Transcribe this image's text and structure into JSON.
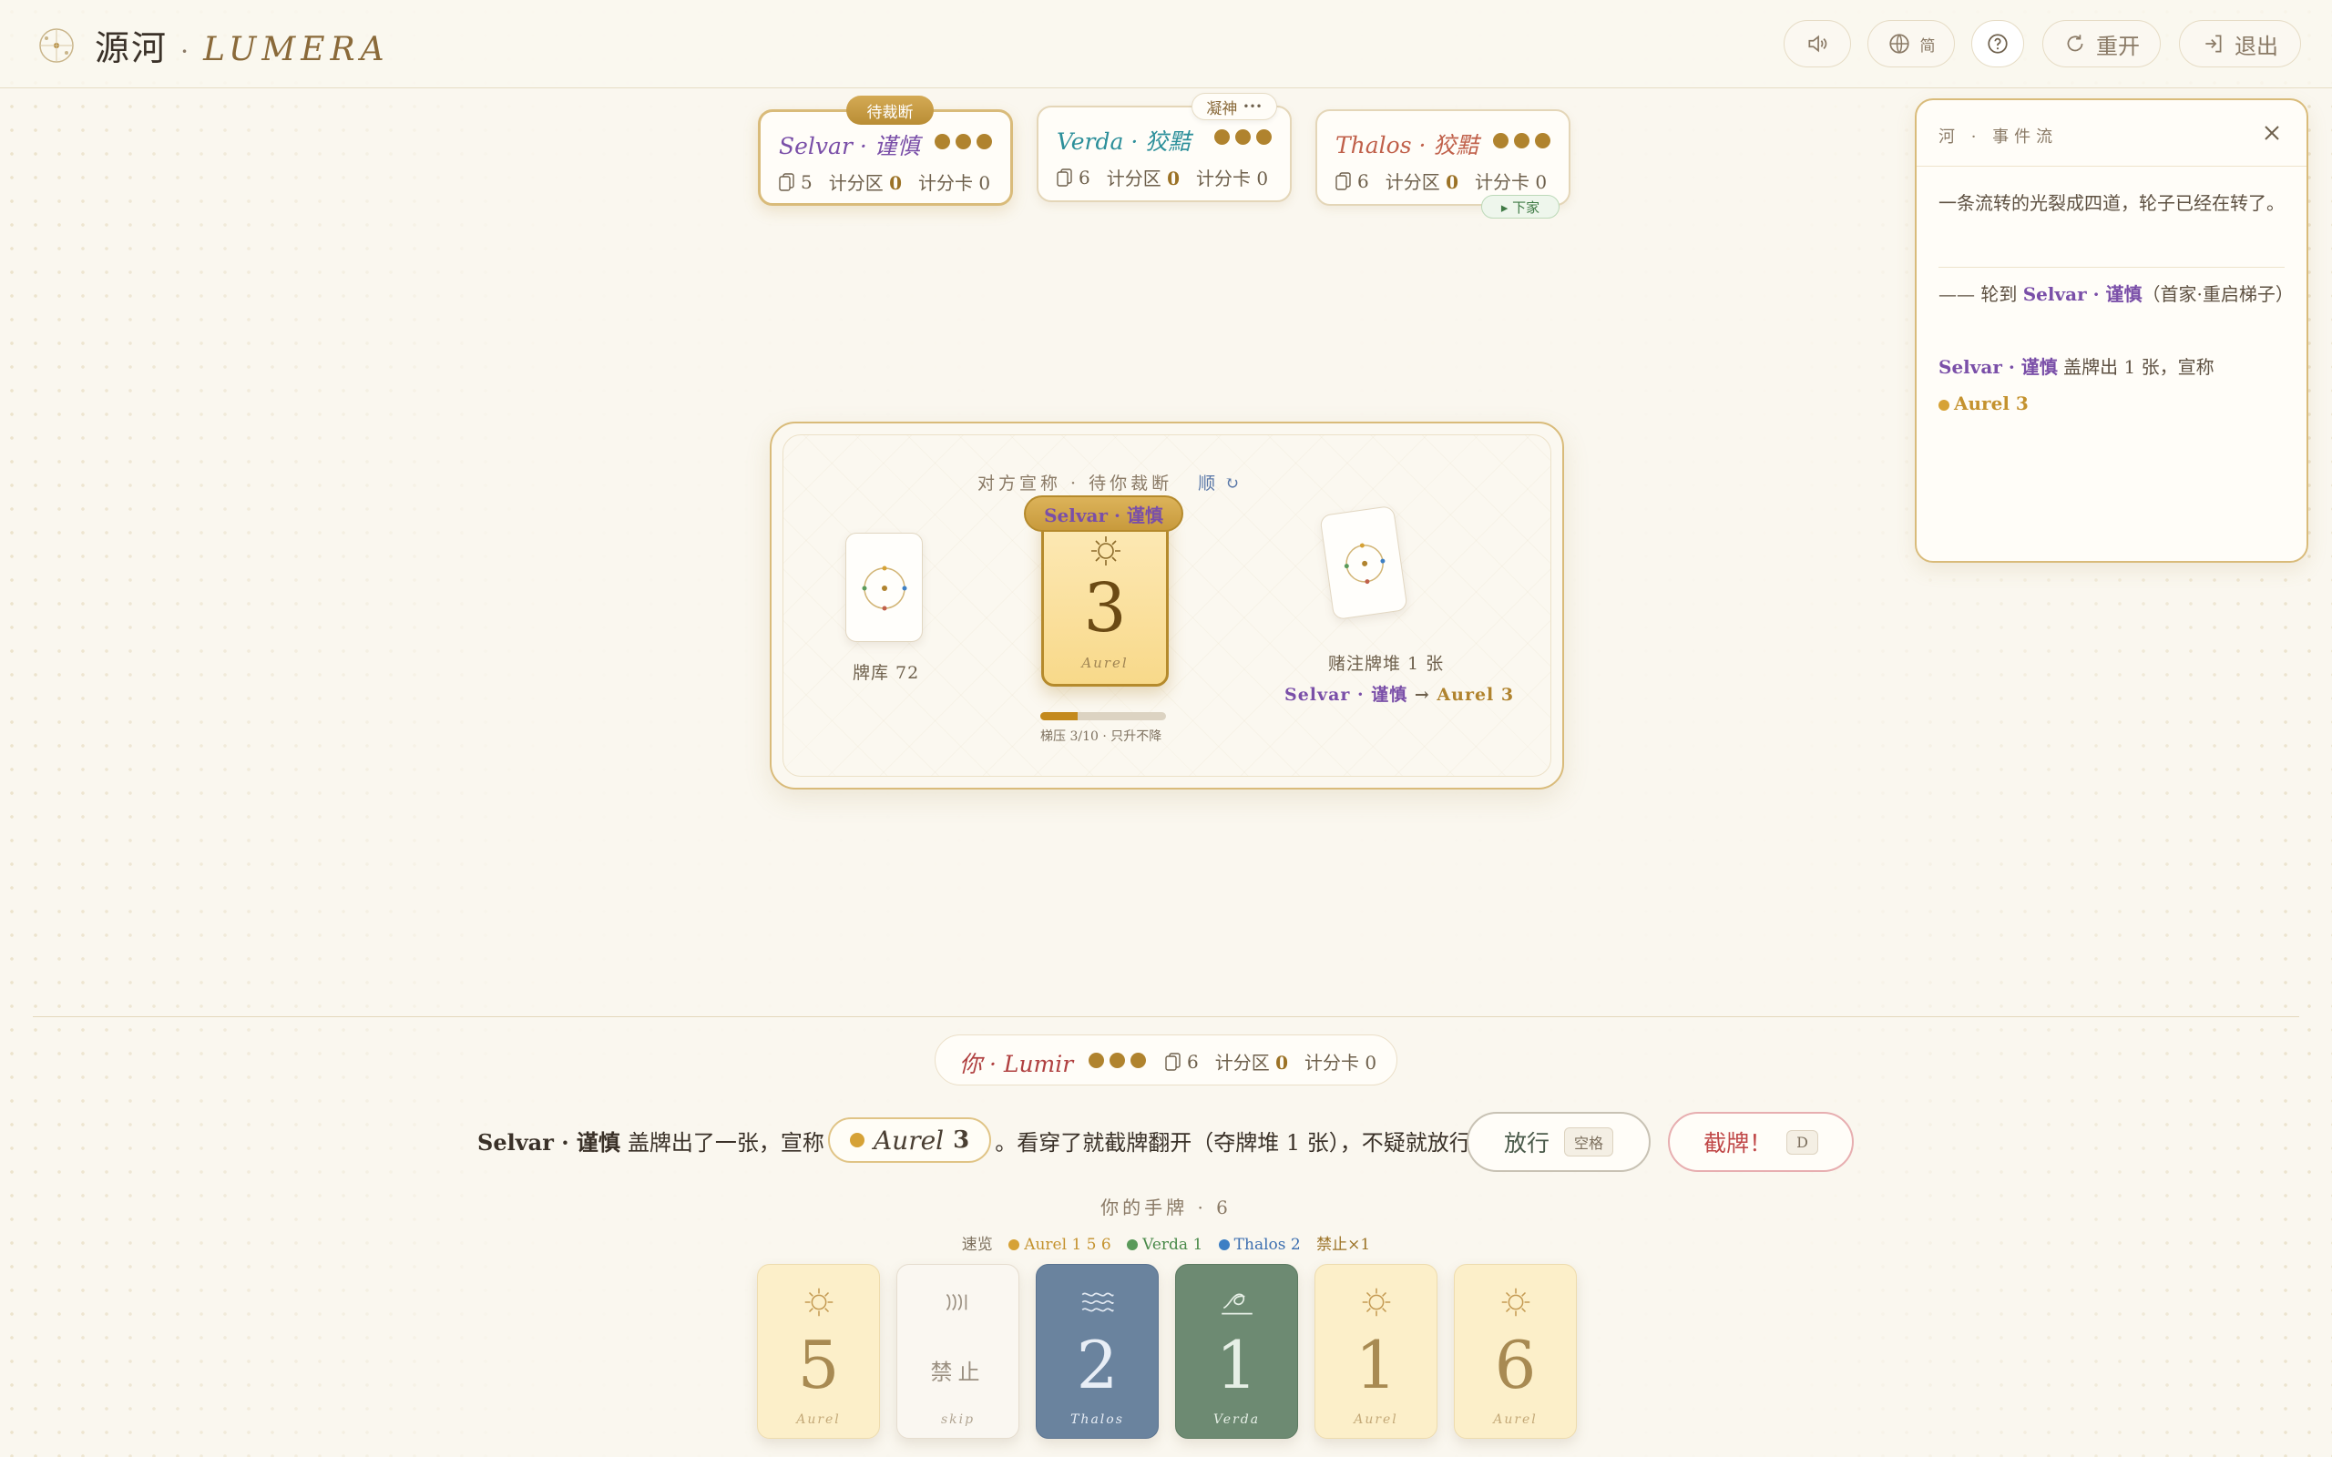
{
  "header": {
    "app_name": "源河",
    "sep": "·",
    "latin_name": "LUMERA",
    "lang_label": "简",
    "restart_label": "重开",
    "exit_label": "退出"
  },
  "players": [
    {
      "name": "Selvar · 谨慎",
      "deck": "5",
      "zone_label": "计分区",
      "zone_value": "0",
      "card_label": "计分卡",
      "card_value": "0",
      "badge": "待裁断",
      "color": "#7a4fa8"
    },
    {
      "name": "Verda · 狡黠",
      "deck": "6",
      "zone_label": "计分区",
      "zone_value": "0",
      "card_label": "计分卡",
      "card_value": "0",
      "badge": "凝神",
      "color": "#2c8f9a"
    },
    {
      "name": "Thalos · 狡黠",
      "deck": "6",
      "zone_label": "计分区",
      "zone_value": "0",
      "card_label": "计分卡",
      "card_value": "0",
      "badge": "▸ 下家",
      "color": "#c0604a"
    }
  ],
  "events": {
    "title": "河 · 事件流",
    "intro": "一条流转的光裂成四道，轮子已经在转了。",
    "turn_prefix": "—— 轮到",
    "turn_player": "Selvar · 谨慎",
    "turn_suffix": "（首家·重启梯子）",
    "play_player": "Selvar · 谨慎",
    "play_text": "盖牌出 1 张，宣称",
    "claim": "Aurel 3"
  },
  "table": {
    "status": "对方宣称 · 待你裁断",
    "status_link": "顺 ↻",
    "deck_label": "牌库 72",
    "played_owner": "Selvar · 谨慎",
    "played_number": "3",
    "played_suit": "Aurel",
    "pressure_label": "梯压 3/10 · 只升不降",
    "pressure_fraction": 0.3,
    "stake_label": "赌注牌堆 1 张",
    "stake_player": "Selvar · 谨慎",
    "stake_arrow": "→",
    "stake_claim": "Aurel 3"
  },
  "you": {
    "name": "你 · Lumir",
    "deck": "6",
    "zone_label": "计分区",
    "zone_value": "0",
    "card_label": "计分卡",
    "card_value": "0"
  },
  "prompt": {
    "player": "Selvar · 谨慎",
    "text1": "盖牌出了一张，宣称",
    "claim_suit": "Aurel",
    "claim_value": "3",
    "text2": "。看穿了就截牌翻开（夺牌堆 1 张），不疑就放行。",
    "pass_label": "放行",
    "pass_key": "空格",
    "challenge_label": "截牌！",
    "challenge_key": "D"
  },
  "hand": {
    "title": "你的手牌 · 6",
    "summary_label": "速览",
    "summary": [
      {
        "text": "Aurel 1 5 6",
        "color": "#d6a236"
      },
      {
        "text": "Verda 1",
        "color": "#5a9a5a"
      },
      {
        "text": "Thalos 2",
        "color": "#3d7fc4"
      },
      {
        "text": "禁止×1",
        "color": ""
      }
    ],
    "cards": [
      {
        "type": "aurel",
        "num": "5",
        "label": "Aurel",
        "icon": "sun-icon"
      },
      {
        "type": "skipc",
        "num": "",
        "text": "禁止",
        "label": "skip",
        "icon": "skip-icon"
      },
      {
        "type": "thalos",
        "num": "2",
        "label": "Thalos",
        "icon": "waves-icon"
      },
      {
        "type": "verda",
        "num": "1",
        "label": "Verda",
        "icon": "leaf-icon"
      },
      {
        "type": "aurel",
        "num": "1",
        "label": "Aurel",
        "icon": "sun-icon"
      },
      {
        "type": "aurel",
        "num": "6",
        "label": "Aurel",
        "icon": "sun-icon"
      }
    ]
  },
  "colors": {
    "gold": "#b0832e",
    "purple": "#7a4fa8",
    "red": "#b04040",
    "cream": "#faf7ef"
  }
}
